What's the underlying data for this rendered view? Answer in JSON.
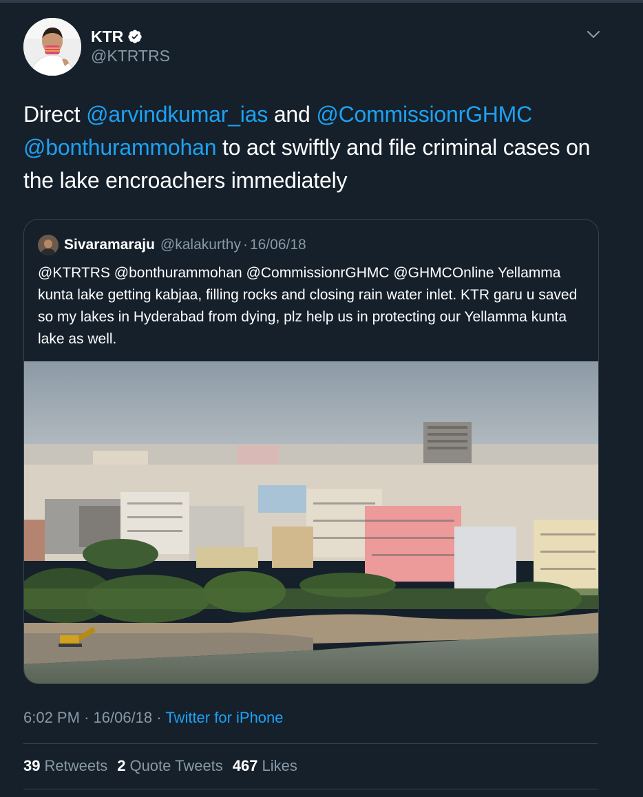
{
  "tweet": {
    "author": {
      "name": "KTR",
      "handle": "@KTRTRS",
      "verified": true
    },
    "text": {
      "part1": "Direct ",
      "mention1": "@arvindkumar_ias",
      "part2": " and ",
      "mention2": "@CommissionrGHMC",
      "mention3": "@bonthurammohan",
      "part3": " to act swiftly and file criminal cases on the lake encroachers immediately"
    },
    "quoted": {
      "name": "Sivaramaraju",
      "handle": "@kalakurthy",
      "separator": "·",
      "date": "16/06/18",
      "text": "@KTRTRS @bonthurammohan @CommissionrGHMC @GHMCOnline Yellamma kunta lake getting kabjaa, filling rocks and closing rain water inlet. KTR garu u saved so my lakes in Hyderabad from dying, plz help us in protecting our Yellamma kunta lake as well."
    },
    "meta": {
      "time": "6:02 PM",
      "separator": "·",
      "date": "16/06/18",
      "source": "Twitter for iPhone"
    },
    "stats": {
      "retweets_count": "39",
      "retweets_label": "Retweets",
      "quotes_count": "2",
      "quotes_label": "Quote Tweets",
      "likes_count": "467",
      "likes_label": "Likes"
    }
  },
  "colors": {
    "background": "#15202b",
    "accent": "#1da1f2",
    "secondary_text": "#8899a6",
    "border": "#38444d"
  },
  "icons": {
    "verified": "verified-badge-icon",
    "caret": "chevron-down-icon"
  }
}
